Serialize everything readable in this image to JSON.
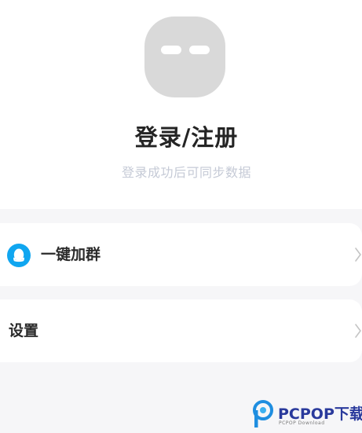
{
  "profile": {
    "avatar_icon": "default-avatar-face-icon",
    "title": "登录/注册",
    "subtitle": "登录成功后可同步数据"
  },
  "menu": {
    "items": [
      {
        "label": "一键加群",
        "icon": "qq-penguin-icon",
        "accent": "#10a6f0"
      },
      {
        "label": "设置",
        "icon": "none"
      }
    ]
  },
  "watermark": {
    "brand": "PCPOP下载",
    "sub": "PCPOP Download",
    "color": "#2a3a9c"
  }
}
